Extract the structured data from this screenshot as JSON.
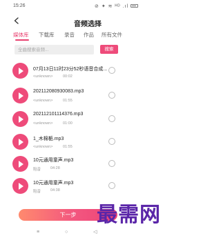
{
  "status_bar": {
    "time": "15:26",
    "icons": "⊘ ✦ ≋ ᴴᴰ .ıl"
  },
  "header": {
    "title": "音频选择",
    "back_icon": "chevron-left-icon"
  },
  "tabs": [
    {
      "label": "媒体库",
      "active": true
    },
    {
      "label": "下载库",
      "active": false
    },
    {
      "label": "录音",
      "active": false
    },
    {
      "label": "作品",
      "active": false
    },
    {
      "label": "所有文件",
      "active": false
    }
  ],
  "search": {
    "placeholder": "全曲搜索音频...",
    "button_label": "搜索"
  },
  "items": [
    {
      "title": "07月13日11时23分52秒语音合成...",
      "artist": "<unknown>",
      "duration": "00:02"
    },
    {
      "title": "20211208093008​3.mp3",
      "artist": "<unknown>",
      "duration": "01:55"
    },
    {
      "title": "20211210111437​6.mp3",
      "artist": "<unknown>",
      "duration": "01:00"
    },
    {
      "title": "1_木棉栀.mp3",
      "artist": "<unknown>",
      "duration": "01:55"
    },
    {
      "title": "10元通用童声.mp3",
      "artist": "阻音",
      "duration": "04:28"
    },
    {
      "title": "10元通用童声.mp3",
      "artist": "阻音",
      "duration": "04:38"
    }
  ],
  "next_button": {
    "label": "下一步"
  },
  "nav": {
    "menu": "≡",
    "home": "○",
    "back": "◁"
  },
  "watermark": "最需网",
  "colors": {
    "accent": "#ee4b7a",
    "watermark": "#5a25a8"
  }
}
